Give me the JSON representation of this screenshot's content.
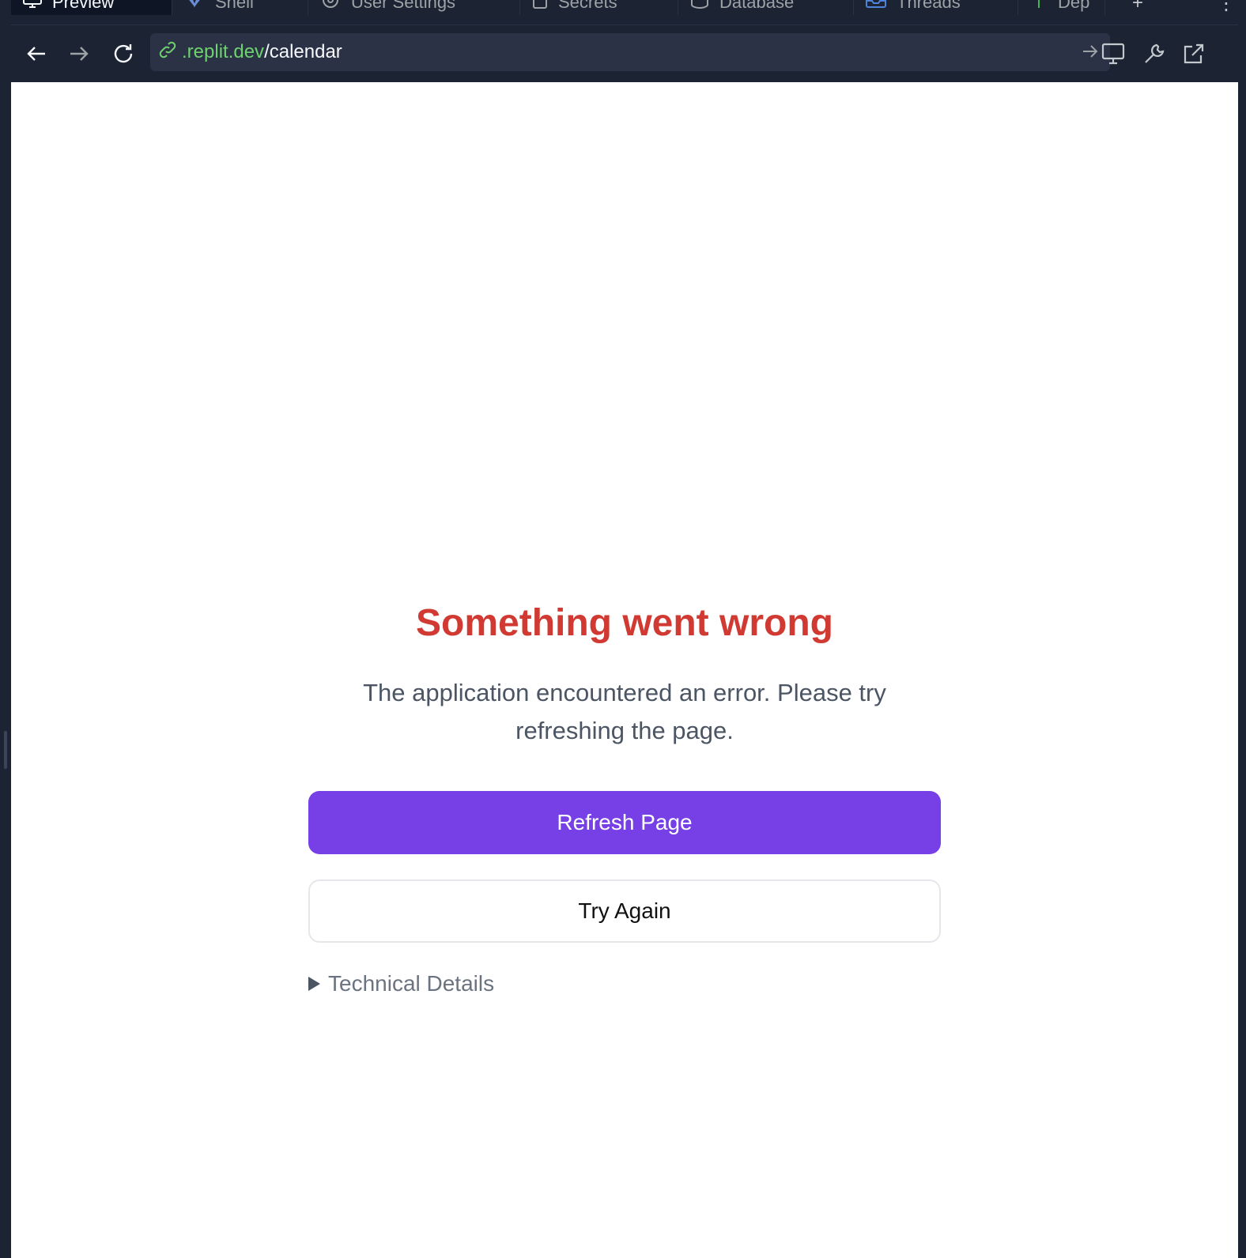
{
  "tabs": [
    {
      "label": "Preview",
      "icon": "monitor-icon",
      "active": true
    },
    {
      "label": "Shell",
      "icon": "shell-icon",
      "active": false
    },
    {
      "label": "User Settings",
      "icon": "gear-icon",
      "active": false
    },
    {
      "label": "Secrets",
      "icon": "lock-icon",
      "active": false
    },
    {
      "label": "Database",
      "icon": "database-icon",
      "active": false
    },
    {
      "label": "Threads",
      "icon": "inbox-icon",
      "active": false
    },
    {
      "label": "Dep",
      "icon": "deploy-icon",
      "active": false
    }
  ],
  "url": {
    "host": ".replit.dev",
    "path": "/calendar"
  },
  "error": {
    "title": "Something went wrong",
    "message": "The application encountered an error. Please try refreshing the page.",
    "refresh_label": "Refresh Page",
    "retry_label": "Try Again",
    "details_label": "Technical Details"
  },
  "colors": {
    "title_red": "#d13a32",
    "primary_purple": "#7640e6",
    "url_green": "#6ed26e",
    "chrome_bg": "#1c2333"
  }
}
